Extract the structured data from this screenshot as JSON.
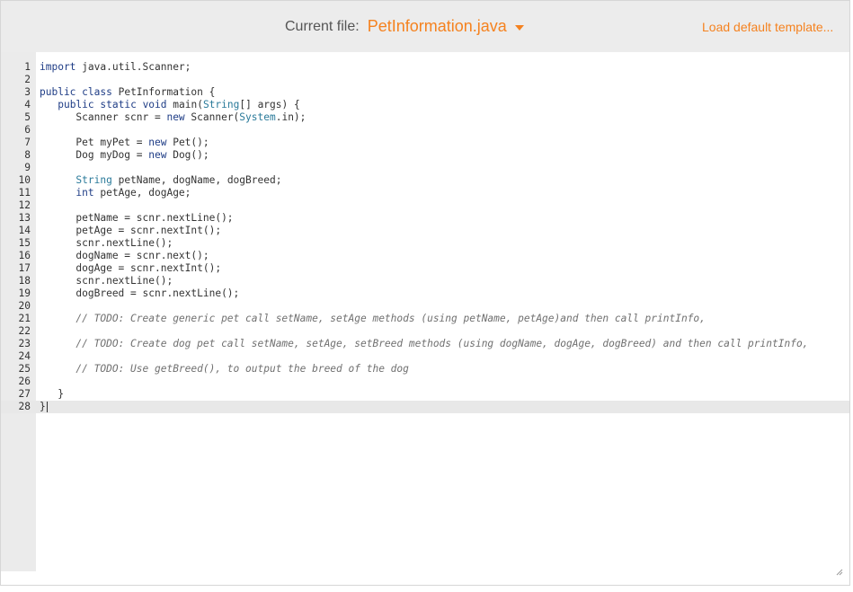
{
  "header": {
    "current_file_label": "Current file:",
    "file_name": "PetInformation.java",
    "load_template": "Load default template..."
  },
  "colors": {
    "accent": "#f5821f",
    "topbar_bg": "#ececec",
    "gutter_bg": "#ebebeb",
    "keyword": "#1f3d86",
    "type": "#2a7a9a",
    "comment": "#707070"
  },
  "editor": {
    "active_line": 28,
    "lines": [
      "import java.util.Scanner;",
      "",
      "public class PetInformation {",
      "   public static void main(String[] args) {",
      "      Scanner scnr = new Scanner(System.in);",
      "",
      "      Pet myPet = new Pet();",
      "      Dog myDog = new Dog();",
      "",
      "      String petName, dogName, dogBreed;",
      "      int petAge, dogAge;",
      "",
      "      petName = scnr.nextLine();",
      "      petAge = scnr.nextInt();",
      "      scnr.nextLine();",
      "      dogName = scnr.next();",
      "      dogAge = scnr.nextInt();",
      "      scnr.nextLine();",
      "      dogBreed = scnr.nextLine();",
      "",
      "      // TODO: Create generic pet call setName, setAge methods (using petName, petAge)and then call printInfo,",
      "",
      "      // TODO: Create dog pet call setName, setAge, setBreed methods (using dogName, dogAge, dogBreed) and then call printInfo,",
      "",
      "      // TODO: Use getBreed(), to output the breed of the dog",
      "",
      "   }",
      "}"
    ]
  }
}
